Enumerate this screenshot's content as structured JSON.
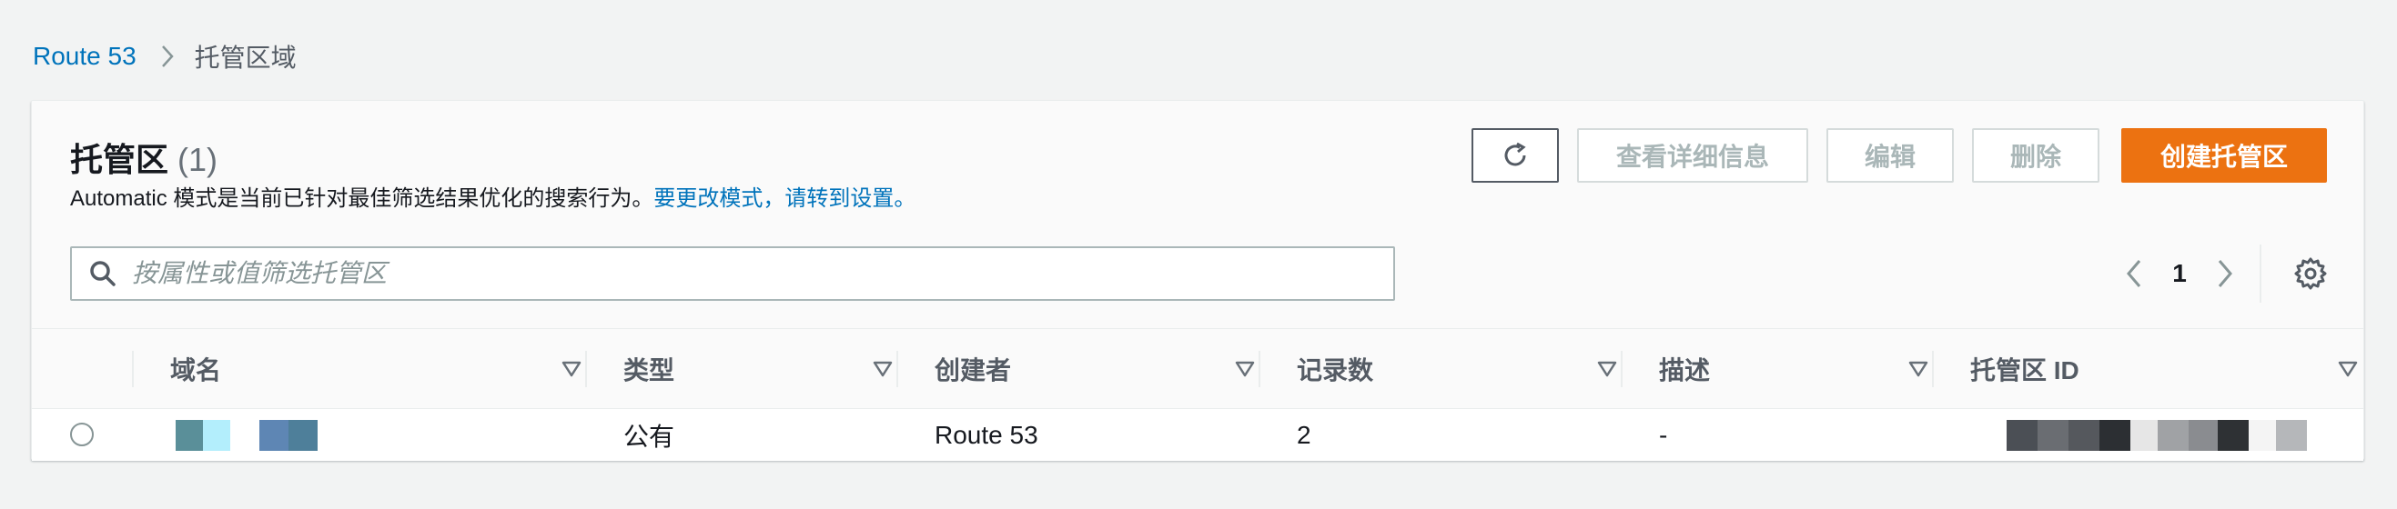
{
  "breadcrumb": {
    "root": "Route 53",
    "current": "托管区域"
  },
  "panel": {
    "title": "托管区",
    "count": "(1)",
    "description_prefix": "Automatic 模式是当前已针对最佳筛选结果优化的搜索行为。",
    "description_link": "要更改模式，请转到设置。"
  },
  "toolbar": {
    "refresh_icon": "refresh-icon",
    "details_label": "查看详细信息",
    "edit_label": "编辑",
    "delete_label": "删除",
    "create_label": "创建托管区"
  },
  "search": {
    "placeholder": "按属性或值筛选托管区"
  },
  "pagination": {
    "current_page": "1"
  },
  "table": {
    "columns": [
      {
        "label": "域名"
      },
      {
        "label": "类型"
      },
      {
        "label": "创建者"
      },
      {
        "label": "记录数"
      },
      {
        "label": "描述"
      },
      {
        "label": "托管区 ID"
      }
    ],
    "rows": [
      {
        "domain": "",
        "type": "公有",
        "created_by": "Route 53",
        "record_count": "2",
        "description": "-",
        "zone_id": ""
      }
    ]
  },
  "colors": {
    "link": "#0073bb",
    "primary_button": "#ec7211",
    "background": "#f2f3f3"
  }
}
